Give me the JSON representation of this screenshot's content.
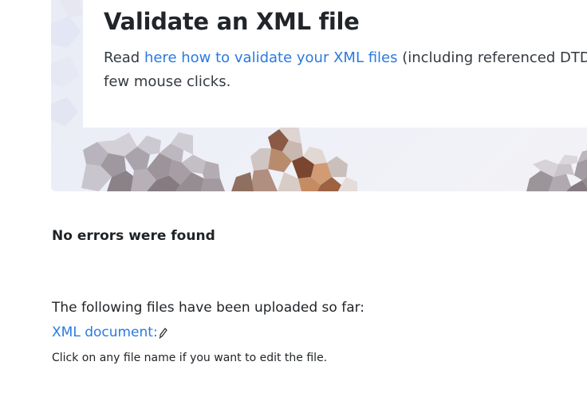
{
  "hero": {
    "title": "Validate an XML file",
    "text_prefix": "Read ",
    "link_label": "here how to validate your XML files",
    "text_suffix": " (including referenced DTDs)",
    "text_line2": "few mouse clicks."
  },
  "result": {
    "message": "No errors were found"
  },
  "uploads": {
    "label": "The following files have been uploaded so far:",
    "files": [
      {
        "name": "XML document:",
        "icon": "pencil-icon"
      }
    ],
    "hint": "Click on any file name if you want to edit the file."
  },
  "colors": {
    "link": "#2a7ae2",
    "text": "#212529",
    "hero_bg": "#eef0f8"
  }
}
